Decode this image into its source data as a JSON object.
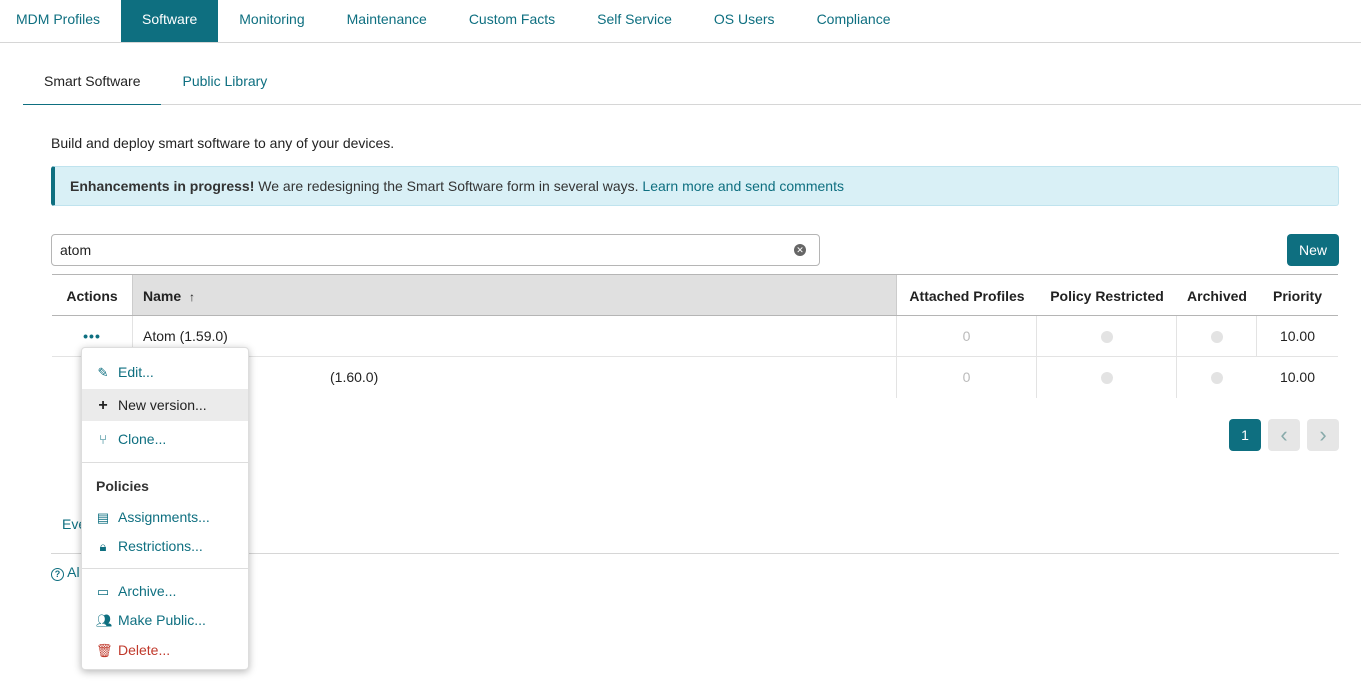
{
  "nav": {
    "tabs": [
      "MDM Profiles",
      "Software",
      "Monitoring",
      "Maintenance",
      "Custom Facts",
      "Self Service",
      "OS Users",
      "Compliance"
    ],
    "active": "Software"
  },
  "subtabs": [
    "Smart Software",
    "Public Library"
  ],
  "description": "Build and deploy smart software to any of your devices.",
  "banner": {
    "bold": "Enhancements in progress!",
    "text": " We are redesigning the Smart Software form in several ways. ",
    "link": "Learn more and send comments"
  },
  "search": {
    "value": "atom"
  },
  "new_button": "New",
  "table": {
    "headers": {
      "actions": "Actions",
      "name": "Name",
      "sort_icon": "↑",
      "attached": "Attached Profiles",
      "policy": "Policy Restricted",
      "archived": "Archived",
      "priority": "Priority"
    },
    "rows": [
      {
        "actions": "•••",
        "name": "Atom (1.59.0)",
        "attached": "0",
        "priority": "10.00"
      },
      {
        "actions": "",
        "name": "Atom (1.60.0)",
        "name_visible": "(1.60.0)",
        "attached": "0",
        "priority": "10.00"
      }
    ]
  },
  "pager": {
    "current": "1",
    "prev": "‹",
    "next": "›"
  },
  "partial_texts": {
    "link1": "Eve",
    "link2": "Al"
  },
  "menu": {
    "edit": "Edit...",
    "new_version": "New version...",
    "clone": "Clone...",
    "policies_header": "Policies",
    "assignments": "Assignments...",
    "restrictions": "Restrictions...",
    "archive": "Archive...",
    "make_public": "Make Public...",
    "delete": "Delete..."
  },
  "colors": {
    "accent": "#0e6f80",
    "banner_bg": "#d9f0f6",
    "danger": "#c0392b"
  }
}
